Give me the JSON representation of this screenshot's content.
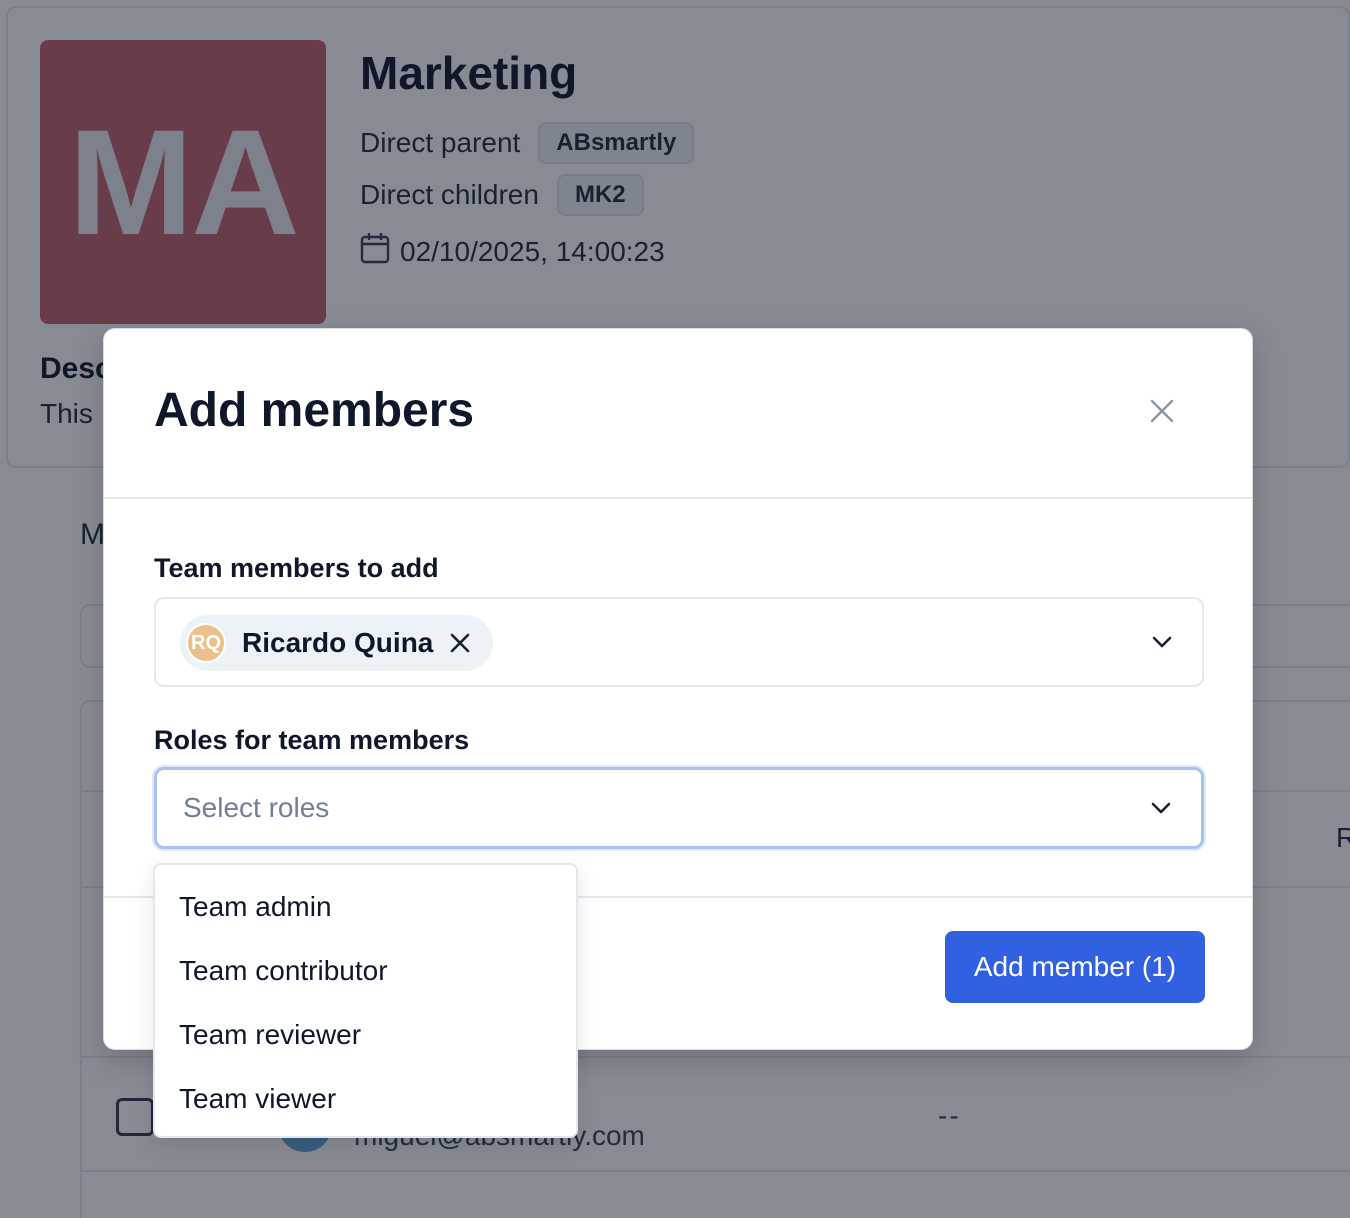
{
  "team": {
    "initials": "MA",
    "name": "Marketing",
    "parent_label": "Direct parent",
    "parent_value": "ABsmartly",
    "children_label": "Direct children",
    "children_value": "MK2",
    "created": "02/10/2025, 14:00:23",
    "description_title": "Desc",
    "description_text": "This",
    "avatar_color": "#c0616a"
  },
  "members_section": {
    "title": "M",
    "column_r": "R",
    "row": {
      "email": "miguel@absmartly.com",
      "col1": "--",
      "col2": "--"
    }
  },
  "modal": {
    "title": "Add members",
    "members_field": {
      "label": "Team members to add",
      "selected": [
        {
          "initials": "RQ",
          "name": "Ricardo Quina",
          "avatar_color": "#ecc08a"
        }
      ]
    },
    "roles_field": {
      "label": "Roles for team members",
      "placeholder": "Select roles",
      "options": [
        "Team admin",
        "Team contributor",
        "Team reviewer",
        "Team viewer"
      ]
    },
    "submit_label": "Add member (1)",
    "accent_color": "#3161e0"
  }
}
